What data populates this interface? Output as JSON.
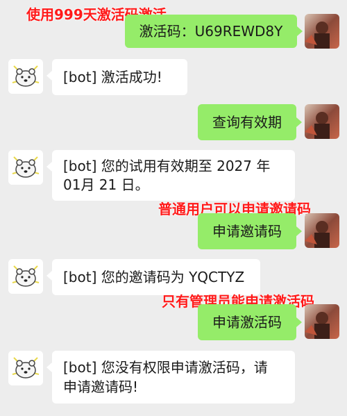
{
  "annotations": {
    "activate_999": "使用999天激活码激活",
    "normal_user_invite": "普通用户可以申请邀请码",
    "admin_activate": "只有管理员能申请激活码"
  },
  "messages": [
    {
      "sender": "user",
      "text": "激活码：U69REWD8Y"
    },
    {
      "sender": "bot",
      "text": "[bot] 激活成功!"
    },
    {
      "sender": "user",
      "text": "查询有效期"
    },
    {
      "sender": "bot",
      "line1": "[bot] 您的试用有效期至 2027 年",
      "line2": "01月 21 日。"
    },
    {
      "sender": "user",
      "text": "申请邀请码"
    },
    {
      "sender": "bot",
      "text": "[bot] 您的邀请码为 YQCTYZ"
    },
    {
      "sender": "user",
      "text": "申请激活码"
    },
    {
      "sender": "bot",
      "line1": "[bot] 您没有权限申请激活码，请",
      "line2": "申请邀请码!"
    }
  ],
  "colors": {
    "background": "#ededed",
    "user_bubble": "#95ec69",
    "bot_bubble": "#ffffff",
    "annotation": "#ff1a1a"
  },
  "icons": {
    "user_avatar": "user-avatar-photo",
    "bot_avatar": "cartoon-bear-icon"
  }
}
